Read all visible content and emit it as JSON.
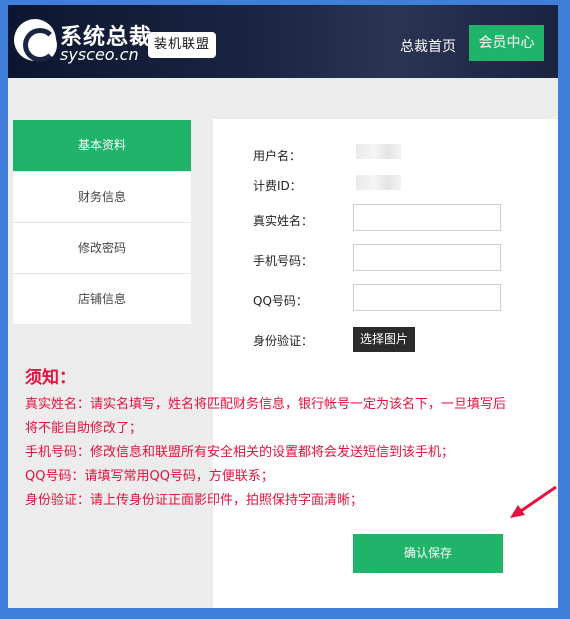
{
  "header": {
    "logo_cn": "系统总裁",
    "logo_en": "sysceo.cn",
    "badge": "装机联盟",
    "nav_home": "总裁首页",
    "nav_member": "会员中心"
  },
  "sidebar": {
    "items": [
      {
        "label": "基本资料",
        "active": true
      },
      {
        "label": "财务信息",
        "active": false
      },
      {
        "label": "修改密码",
        "active": false
      },
      {
        "label": "店铺信息",
        "active": false
      }
    ]
  },
  "form": {
    "username_label": "用户名：",
    "billing_id_label": "计费ID：",
    "realname_label": "真实姓名：",
    "realname_value": "",
    "phone_label": "手机号码：",
    "phone_value": "",
    "qq_label": "QQ号码：",
    "qq_value": "",
    "id_label": "身份验证：",
    "choose_image": "选择图片",
    "submit": "确认保存"
  },
  "notice": {
    "title": "须知：",
    "line1a": "真实姓名：请实名填写，姓名将匹配财务信息，银行帐号一定为该名下，一旦填写后",
    "line1b": "将不能自助修改了；",
    "line2": "手机号码：修改信息和联盟所有安全相关的设置都将会发送短信到该手机；",
    "line3": "QQ号码：请填写常用QQ号码，方便联系；",
    "line4": "身份验证：请上传身份证正面影印件，拍照保持字面清晰；"
  },
  "colors": {
    "accent": "#20b46a",
    "notice": "#e8103c",
    "border": "#3f7fd9",
    "header_bg": "#1a2542"
  }
}
